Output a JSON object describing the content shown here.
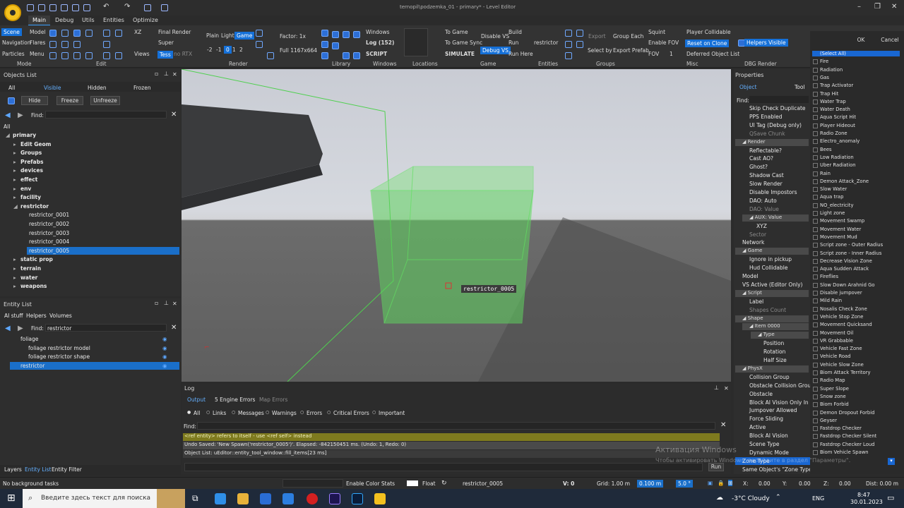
{
  "app": {
    "title": "ternopil\\podzemka_01 - primary* - Level Editor"
  },
  "menu_tabs": [
    "Main",
    "Debug",
    "Utils",
    "Entities",
    "Optimize"
  ],
  "ribbon": {
    "mode": {
      "scene": "Scene",
      "navigation": "Navigation",
      "particles": "Particles",
      "model": "Model",
      "flares": "Flares",
      "menu": "Menu"
    },
    "edit": {
      "xz": "XZ",
      "super": "Super",
      "views": "Views"
    },
    "render": {
      "final_render": "Final Render",
      "super": "Super",
      "tess": "Tess",
      "no_rtx": "no RTX",
      "plain": "Plain",
      "light": "Light",
      "game": "Game",
      "nums": [
        "-2",
        "-1",
        "0",
        "1",
        "2"
      ],
      "factor": "Factor: 1x",
      "full": "Full 1167x664"
    },
    "windows": {
      "windows": "Windows",
      "log": "Log (152)",
      "script": "SCRIPT"
    },
    "game": {
      "to_game": "To Game",
      "to_game_sync": "To Game Sync",
      "simulate": "SIMULATE",
      "disable_vs": "Disable VS",
      "debug_vs": "Debug VS",
      "build": "Build",
      "run": "Run",
      "run_here": "Run Here"
    },
    "entities": {
      "restrictor": "restrictor"
    },
    "groups": {
      "export": "Export",
      "group_each": "Group Each",
      "select_by": "Select by",
      "export_prefab": "Export Prefab"
    },
    "misc": {
      "squint": "Squint",
      "enable_fov": "Enable FOV",
      "fov": "FOV",
      "fov_value": "1",
      "player_collidable": "Player Collidable",
      "reset_on_clone": "Reset on Clone",
      "deferred": "Deferred Object List"
    },
    "dbg": {
      "helpers_visible": "Helpers Visible"
    },
    "groups_labels": [
      "Mode",
      "Edit",
      "Render",
      "Library",
      "Windows",
      "Locations",
      "Game",
      "Entities",
      "Groups",
      "Misc",
      "DBG Render"
    ]
  },
  "objects_list": {
    "title": "Objects List",
    "tabs": [
      "All",
      "Visible",
      "Hidden",
      "Frozen"
    ],
    "buttons": [
      "Hide",
      "Freeze",
      "Unfreeze"
    ],
    "find_label": "Find:",
    "root_label": "All",
    "tree": [
      {
        "label": "primary",
        "bold": true,
        "indent": 0
      },
      {
        "label": "Edit Geom",
        "bold": true,
        "indent": 1
      },
      {
        "label": "Groups",
        "bold": true,
        "indent": 1
      },
      {
        "label": "Prefabs",
        "bold": true,
        "indent": 1
      },
      {
        "label": "devices",
        "bold": true,
        "indent": 1
      },
      {
        "label": "effect",
        "bold": true,
        "indent": 1
      },
      {
        "label": "env",
        "bold": true,
        "indent": 1
      },
      {
        "label": "facility",
        "bold": true,
        "indent": 1
      },
      {
        "label": "restrictor",
        "bold": true,
        "indent": 1
      },
      {
        "label": "restrictor_0001",
        "bold": false,
        "indent": 2
      },
      {
        "label": "restrictor_0002",
        "bold": false,
        "indent": 2
      },
      {
        "label": "restrictor_0003",
        "bold": false,
        "indent": 2
      },
      {
        "label": "restrictor_0004",
        "bold": false,
        "indent": 2
      },
      {
        "label": "restrictor_0005",
        "bold": false,
        "indent": 2,
        "selected": true
      },
      {
        "label": "static prop",
        "bold": true,
        "indent": 1
      },
      {
        "label": "terrain",
        "bold": true,
        "indent": 1
      },
      {
        "label": "water",
        "bold": true,
        "indent": 1
      },
      {
        "label": "weapons",
        "bold": true,
        "indent": 1
      }
    ]
  },
  "entity_list": {
    "title": "Entity List",
    "tabs": [
      "AI stuff",
      "Helpers",
      "Volumes"
    ],
    "find_label": "Find:",
    "find_value": "restrictor",
    "items": [
      {
        "label": "foliage",
        "indent": 0
      },
      {
        "label": "foliage restrictor model",
        "indent": 1
      },
      {
        "label": "foliage restrictor shape",
        "indent": 1
      },
      {
        "label": "restrictor",
        "indent": 0,
        "selected": true
      }
    ]
  },
  "bottom_tabs": [
    "Layers",
    "Entity List",
    "Entity Filter"
  ],
  "viewport": {
    "label": "restrictor_0005"
  },
  "log": {
    "title": "Log",
    "tabs": [
      "Output",
      "5 Engine Errors",
      "Map Errors"
    ],
    "filters": [
      "All",
      "Links",
      "Messages",
      "Warnings",
      "Errors",
      "Critical Errors",
      "Important"
    ],
    "find_label": "Find:",
    "lines": [
      "<ref entity> refers to itself - use <ref self> instead",
      "Undo Saved: 'New Spawn('restrictor_0005')'. Elapsed: -842150451 ms. (Undo: 1, Redo: 0)",
      "Object List: uEditor::entity_tool_window::fill_items[23 ms]"
    ],
    "run_label": "Run"
  },
  "properties": {
    "title": "Properties",
    "tabs": [
      "Object",
      "Tool"
    ],
    "find_label": "Find:",
    "rows": [
      {
        "label": "Skip Check Duplicate",
        "type": "item"
      },
      {
        "label": "PPS Enabled",
        "type": "item"
      },
      {
        "label": "UI Tag (Debug only)",
        "type": "item"
      },
      {
        "label": "QSave Chunk",
        "type": "dim"
      },
      {
        "label": "Render",
        "type": "section"
      },
      {
        "label": "Reflectable?",
        "type": "item"
      },
      {
        "label": "Cast AO?",
        "type": "item"
      },
      {
        "label": "Ghost?",
        "type": "item"
      },
      {
        "label": "Shadow Cast",
        "type": "item"
      },
      {
        "label": "Slow Render",
        "type": "item"
      },
      {
        "label": "Disable Impostors",
        "type": "item"
      },
      {
        "label": "DAO: Auto",
        "type": "item"
      },
      {
        "label": "DAO: Value",
        "type": "dim"
      },
      {
        "label": "AUX: Value",
        "type": "subsection"
      },
      {
        "label": "XYZ",
        "type": "sub"
      },
      {
        "label": "Sector",
        "type": "dim"
      },
      {
        "label": "Network",
        "type": "top"
      },
      {
        "label": "Game",
        "type": "section"
      },
      {
        "label": "Ignore in pickup",
        "type": "item"
      },
      {
        "label": "Hud Collidable",
        "type": "item"
      },
      {
        "label": "Model",
        "type": "top"
      },
      {
        "label": "VS Active (Editor Only)",
        "type": "top"
      },
      {
        "label": "Script",
        "type": "section"
      },
      {
        "label": "Label",
        "type": "item"
      },
      {
        "label": "Shapes Count",
        "type": "dim"
      },
      {
        "label": "Shape",
        "type": "section"
      },
      {
        "label": "Item 0000",
        "type": "subsection"
      },
      {
        "label": "Type",
        "type": "subsection2"
      },
      {
        "label": "Position",
        "type": "sub2"
      },
      {
        "label": "Rotation",
        "type": "sub2"
      },
      {
        "label": "Half Size",
        "type": "sub2"
      },
      {
        "label": "PhysX",
        "type": "section"
      },
      {
        "label": "Collision Group",
        "type": "item"
      },
      {
        "label": "Obstacle Collision Group",
        "type": "item"
      },
      {
        "label": "Obstacle",
        "type": "item"
      },
      {
        "label": "Block AI Vision Only In Free",
        "type": "item"
      },
      {
        "label": "Jumpover Allowed",
        "type": "item"
      },
      {
        "label": "Force Sliding",
        "type": "item"
      },
      {
        "label": "Active",
        "type": "item"
      },
      {
        "label": "Block AI Vision",
        "type": "item"
      },
      {
        "label": "Scene Type",
        "type": "item"
      },
      {
        "label": "Dynamic Mode",
        "type": "item"
      }
    ],
    "zone_type": "Zone Type",
    "same_zone": "Same Object's \"Zone Type\" Onl"
  },
  "zone_dialog": {
    "ok": "OK",
    "cancel": "Cancel",
    "items": [
      "(Select All)",
      "Fire",
      "Radiation",
      "Gas",
      "Trap Activator",
      "Trap Hit",
      "Water Trap",
      "Water Death",
      "Aqua Script Hit",
      "Player Hideout",
      "Radio Zone",
      "Electro_anomaly",
      "Bees",
      "Low Radiation",
      "Uber Radiation",
      "Rain",
      "Demon Attack_Zone",
      "Slow Water",
      "Aqua trap",
      "NO_electricity",
      "Light zone",
      "Movement Swamp",
      "Movement Water",
      "Movement Mud",
      "Script zone - Outer Radius",
      "Script zone - Inner Radius",
      "Decrease Vision Zone",
      "Aqua Sudden Attack",
      "Fireflies",
      "Slow Down Arahnid Go",
      "Disable jumpover",
      "Mild Rain",
      "Nosalis Check Zone",
      "Vehicle Stop Zone",
      "Movement Quicksand",
      "Movement Oil",
      "VR Grabbable",
      "Vehicle Fast Zone",
      "Vehicle Road",
      "Vehicle Slow Zone",
      "Biom Attack Territory",
      "Radio Map",
      "Super Slope",
      "Snow zone",
      "Biom Forbid",
      "Demon Dropout Forbid",
      "Geyser",
      "Fastdrop Checker",
      "Fastdrop Checker Silent",
      "Fastdrop Checker Loud",
      "Biom Vehicle Spawn"
    ]
  },
  "watermark": {
    "line1": "Активация Windows",
    "line2": "Чтобы активировать Windows, перейдите в раздел \"Параметры\"."
  },
  "status": {
    "tasks": "No background tasks",
    "enable_color_stats": "Enable Color Stats",
    "float": "Float",
    "object": "restrictor_0005",
    "v": "V: 0",
    "grid": "Grid: 1.00 m",
    "snap": "0.100 m",
    "angle": "5.0 °",
    "x_label": "X:",
    "x": "0.00",
    "y_label": "Y:",
    "y": "0.00",
    "z_label": "Z:",
    "z": "0.00",
    "dist": "Dist: 0.00 m"
  },
  "taskbar": {
    "search_placeholder": "Введите здесь текст для поиска",
    "weather": "-3°C Cloudy",
    "time": "8:47",
    "date": "30.01.2023",
    "lang": "ENG"
  },
  "colors": {
    "accent": "#1a6fc9",
    "volume_green": "#5fd35f"
  }
}
